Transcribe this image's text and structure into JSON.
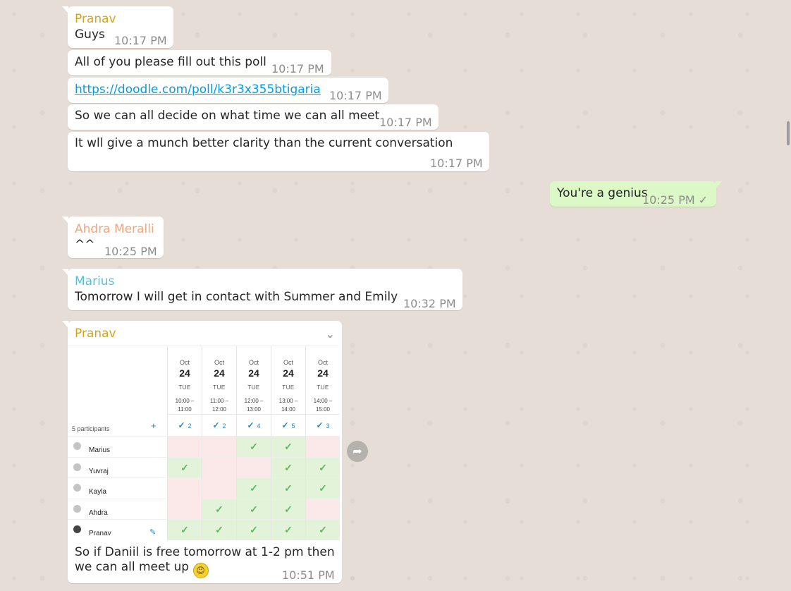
{
  "colors": {
    "chat_background": "#e6ded6",
    "bubble_incoming": "#ffffff",
    "bubble_outgoing": "#dcf8c6",
    "sender_pranav": "#d6a21e",
    "sender_ahdra": "#f2a67c",
    "sender_marius": "#57bedc",
    "link": "#039be5",
    "timestamp": "#8c8c8c",
    "poll_yes": "#e3f3d9",
    "poll_no": "#fbe8e8",
    "poll_check": "#5cb85c"
  },
  "messages": [
    {
      "sender": "Pranav",
      "text": "Guys",
      "time": "10:17 PM"
    },
    {
      "text": "All of you please fill out this poll",
      "time": "10:17 PM"
    },
    {
      "link": "https://doodle.com/poll/k3r3x355btigaria",
      "time": "10:17 PM"
    },
    {
      "text": "So we can all decide on what time we can all meet",
      "time": "10:17 PM"
    },
    {
      "text": "It wll give a munch better clarity than the current conversation",
      "time": "10:17 PM"
    },
    {
      "text": "You're a genius",
      "time": "10:25 PM",
      "status_icon": "single-check-icon"
    },
    {
      "sender": "Ahdra Meralli",
      "text": "^^",
      "time": "10:25 PM"
    },
    {
      "sender": "Marius",
      "text": "Tomorrow I will get in contact with Summer and Emily",
      "time": "10:32 PM"
    },
    {
      "sender": "Pranav",
      "caption_line1": "So if Daniil is free tomorrow at 1-2 pm then",
      "caption_line2": "we can all meet up",
      "emoji": "smiley-emoji-icon",
      "time": "10:51 PM"
    }
  ],
  "poll": {
    "participants_label": "5 participants",
    "add_symbol": "+",
    "slots": [
      {
        "month": "Oct",
        "day": "24",
        "dow": "TUE",
        "start": "10:00 –",
        "end": "11:00",
        "count": "2"
      },
      {
        "month": "Oct",
        "day": "24",
        "dow": "TUE",
        "start": "11:00 –",
        "end": "12:00",
        "count": "2"
      },
      {
        "month": "Oct",
        "day": "24",
        "dow": "TUE",
        "start": "12:00 –",
        "end": "13:00",
        "count": "4"
      },
      {
        "month": "Oct",
        "day": "24",
        "dow": "TUE",
        "start": "13:00 –",
        "end": "14:00",
        "count": "5"
      },
      {
        "month": "Oct",
        "day": "24",
        "dow": "TUE",
        "start": "14:00 –",
        "end": "15:00",
        "count": "3"
      }
    ],
    "participants": [
      {
        "name": "Marius",
        "votes": [
          false,
          false,
          true,
          true,
          false
        ]
      },
      {
        "name": "Yuvraj",
        "votes": [
          true,
          false,
          false,
          true,
          true
        ]
      },
      {
        "name": "Kayla",
        "votes": [
          false,
          false,
          true,
          true,
          true
        ]
      },
      {
        "name": "Ahdra",
        "votes": [
          false,
          true,
          true,
          true,
          false
        ]
      },
      {
        "name": "Pranav",
        "votes": [
          true,
          true,
          true,
          true,
          true
        ],
        "is_self": true
      }
    ]
  }
}
